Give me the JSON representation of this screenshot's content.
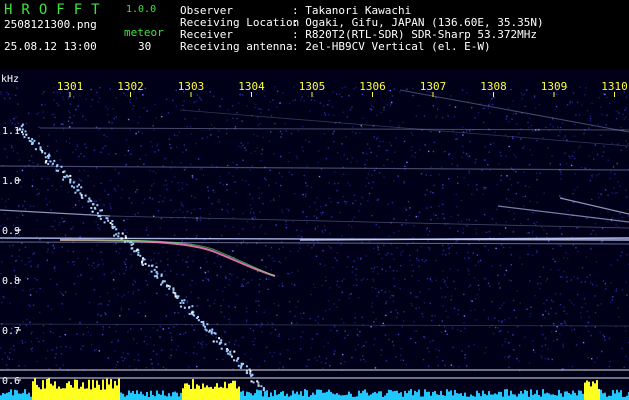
{
  "app": {
    "logo": "HROFFT",
    "version": "1.0.0",
    "filename": "2508121300.png",
    "datetime": "25.08.12 13:00",
    "detection_label": "meteor",
    "detection_count": "30"
  },
  "info": {
    "rows": [
      {
        "label": "Observer",
        "value": ": Takanori Kawachi"
      },
      {
        "label": "Receiving Location",
        "value": ": Ogaki, Gifu, JAPAN (136.60E, 35.35N)"
      },
      {
        "label": "Receiver",
        "value": ": R820T2(RTL-SDR) SDR-Sharp 53.372MHz"
      },
      {
        "label": "Receiving antenna",
        "value": ": 2el-HB9CV Vertical (el. E-W)"
      }
    ]
  },
  "spectrogram": {
    "y_unit": "kHz",
    "x_ticks": [
      "1301",
      "1302",
      "1303",
      "1304",
      "1305",
      "1306",
      "1307",
      "1308",
      "1309",
      "1310"
    ],
    "y_ticks": [
      "1.1",
      "1.0",
      "0.9",
      "0.8",
      "0.7",
      "0.6"
    ],
    "colors": {
      "background": "#000018",
      "tick_x": "#ffff40",
      "tick_y": "#ffffff",
      "trace": "#c8d0ff",
      "meteor": "#9fd0ff",
      "bar_yellow": "#ffff20",
      "bar_cyan": "#20c8ff"
    }
  }
}
